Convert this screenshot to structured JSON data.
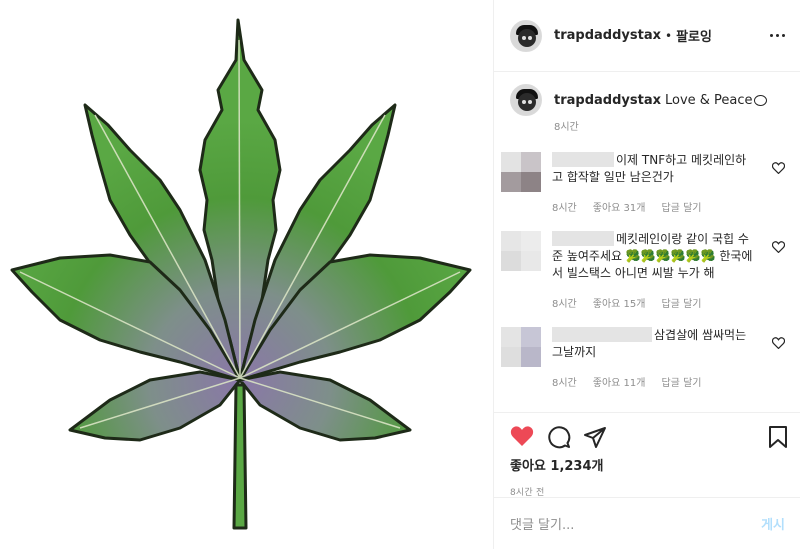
{
  "post": {
    "username": "trapdaddystax",
    "follow_label": "팔로잉",
    "caption_text": "Love & Peace",
    "caption_time": "8시간",
    "image_subject": "cannabis-leaf"
  },
  "comments": [
    {
      "text": "이제 TNF하고 메킷레인하고 합작할 일만 남은건가",
      "time": "8시간",
      "likes": "좋아요 31개",
      "reply": "답글 달기",
      "avatar_colors": [
        "#e3e3e3",
        "#c9c4c8",
        "#a39b9e",
        "#8d8386"
      ]
    },
    {
      "text": "메킷레인이랑 같이 국힙 수준 높여주세요 🥦🥦🥦🥦🥦🥦 한국에서 빌스택스 아니면 씨발 누가 해",
      "time": "8시간",
      "likes": "좋아요 15개",
      "reply": "답글 달기",
      "avatar_colors": [
        "#e6e6e6",
        "#ececec",
        "#dcdcdc",
        "#e8e8e8"
      ]
    },
    {
      "text": "삼겹살에 쌈싸먹는 그날까지",
      "time": "8시간",
      "likes": "좋아요 11개",
      "reply": "답글 달기",
      "avatar_colors": [
        "#e4e4e4",
        "#c7c6d6",
        "#dedede",
        "#b9b7c9"
      ]
    }
  ],
  "footer": {
    "likes": "좋아요 1,234개",
    "time": "8시간 전",
    "comment_placeholder": "댓글 달기...",
    "post_label": "게시"
  },
  "colors": {
    "like_red": "#ed4956",
    "post_blue": "#b2dffc",
    "meta_gray": "#8e8e8e",
    "leaf_green": "#4f9a3a",
    "leaf_purple": "#8a77a8"
  }
}
